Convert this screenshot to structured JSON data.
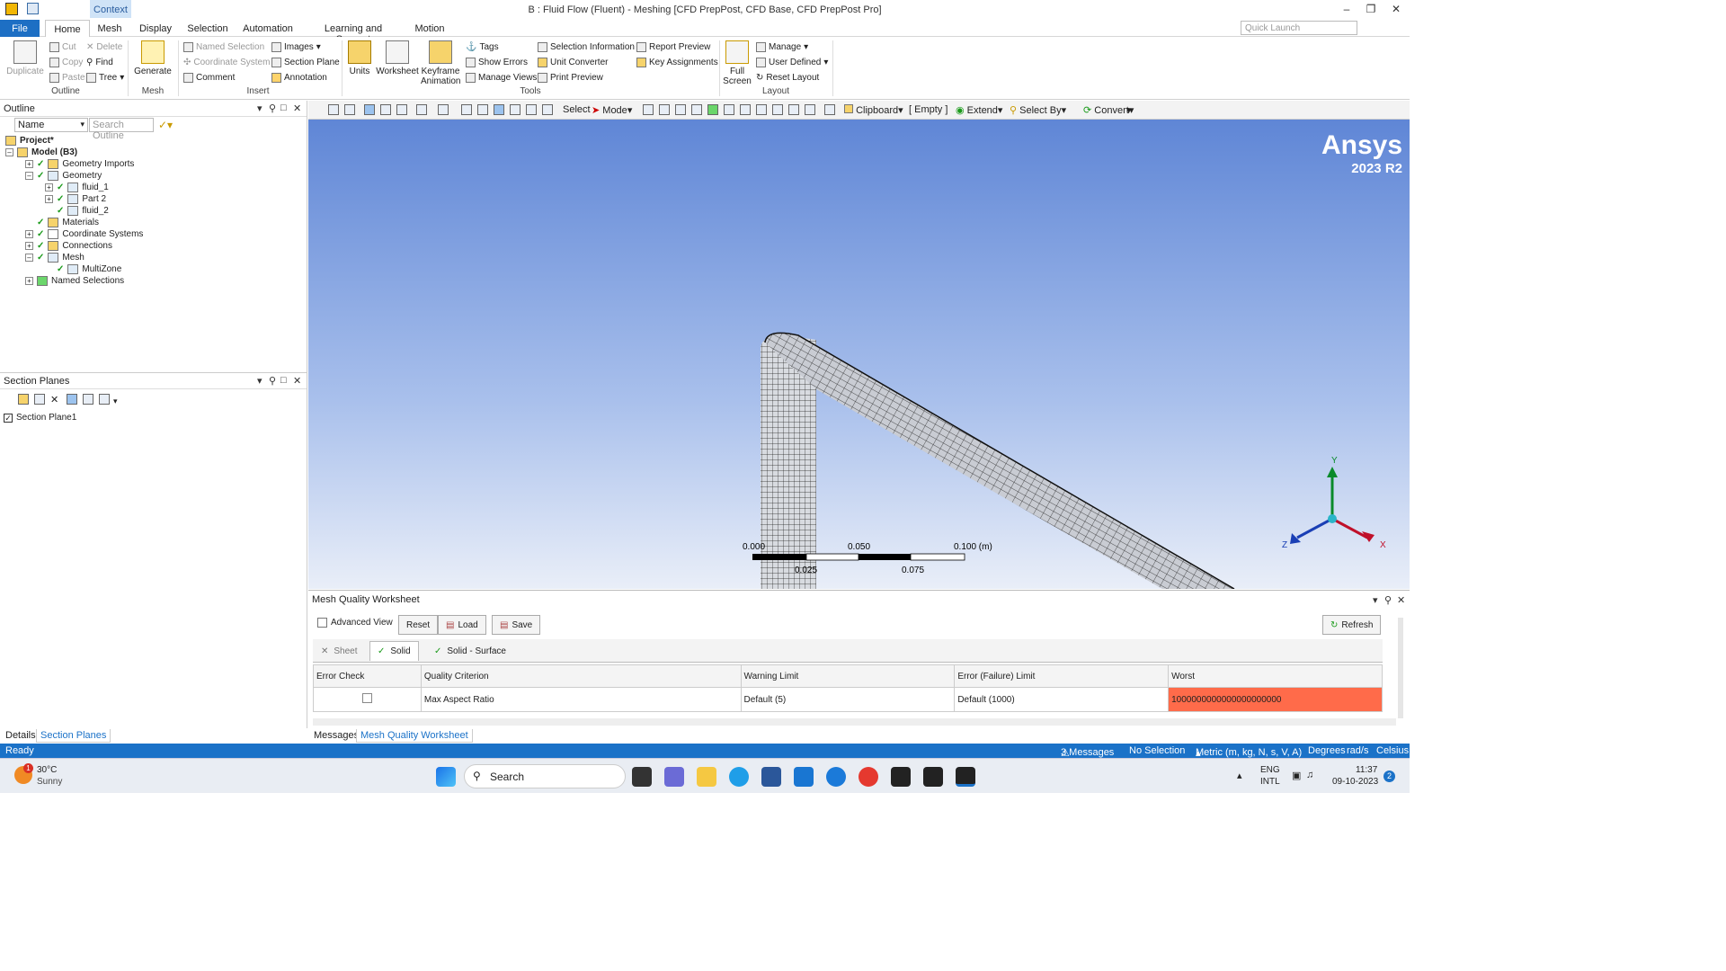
{
  "window": {
    "title": "B : Fluid Flow (Fluent) - Meshing [CFD PrepPost, CFD Base, CFD PrepPost Pro]",
    "context_label": "Context"
  },
  "tabs": [
    "File",
    "Home",
    "Mesh",
    "Display",
    "Selection",
    "Automation",
    "Learning and Support",
    "Motion"
  ],
  "quick_launch": {
    "placeholder": "Quick Launch"
  },
  "ribbon": {
    "outline": {
      "duplicate": "Duplicate",
      "cut": "Cut",
      "copy": "Copy",
      "paste": "Paste",
      "delete": "Delete",
      "find": "Find",
      "tree": "Tree",
      "label": "Outline"
    },
    "mesh": {
      "generate": "Generate",
      "label": "Mesh"
    },
    "insert": {
      "named_selection": "Named Selection",
      "coordinate_system": "Coordinate System",
      "comment": "Comment",
      "images": "Images",
      "section_plane": "Section Plane",
      "annotation": "Annotation",
      "label": "Insert"
    },
    "tools": {
      "units": "Units",
      "worksheet": "Worksheet",
      "keyframe_1": "Keyframe",
      "keyframe_2": "Animation",
      "tags": "Tags",
      "show_errors": "Show Errors",
      "manage_views": "Manage Views",
      "selection_information": "Selection Information",
      "unit_converter": "Unit Converter",
      "print_preview": "Print Preview",
      "report_preview": "Report Preview",
      "key_assignments": "Key Assignments",
      "label": "Tools"
    },
    "layout": {
      "full_1": "Full",
      "full_2": "Screen",
      "manage": "Manage",
      "user_defined": "User Defined",
      "reset_layout": "Reset Layout",
      "label": "Layout"
    }
  },
  "toolbar": {
    "select": "Select",
    "mode": "Mode",
    "clipboard": "Clipboard",
    "empty": "[ Empty ]",
    "extend": "Extend",
    "select_by": "Select By",
    "convert": "Convert"
  },
  "outline": {
    "title": "Outline",
    "filter": "Name",
    "search_placeholder": "Search Outline",
    "tree": [
      {
        "label": "Project*",
        "bold": true
      },
      {
        "label": "Model (B3)",
        "bold": true
      },
      {
        "label": "Geometry Imports"
      },
      {
        "label": "Geometry"
      },
      {
        "label": "fluid_1"
      },
      {
        "label": "Part 2"
      },
      {
        "label": "fluid_2"
      },
      {
        "label": "Materials"
      },
      {
        "label": "Coordinate Systems"
      },
      {
        "label": "Connections"
      },
      {
        "label": "Mesh"
      },
      {
        "label": "MultiZone"
      },
      {
        "label": "Named Selections"
      }
    ]
  },
  "section_planes": {
    "title": "Section Planes",
    "items": [
      "Section Plane1"
    ]
  },
  "viewport": {
    "logo": "Ansys",
    "version": "2023 R2",
    "scale": {
      "labels_top": [
        "0.000",
        "0.050",
        "0.100 (m)"
      ],
      "labels_bottom": [
        "0.025",
        "0.075"
      ]
    },
    "axes": {
      "x": "X",
      "y": "Y",
      "z": "Z"
    }
  },
  "worksheet": {
    "title": "Mesh Quality Worksheet",
    "advanced_view": "Advanced View",
    "reset": "Reset",
    "load": "Load",
    "save": "Save",
    "refresh": "Refresh",
    "tabs": [
      "Sheet",
      "Solid",
      "Solid - Surface"
    ],
    "columns": [
      "Error Check",
      "Quality Criterion",
      "Warning Limit",
      "Error (Failure) Limit",
      "Worst"
    ],
    "rows": [
      {
        "criterion": "Max Aspect Ratio",
        "warning": "Default (5)",
        "error": "Default (1000)",
        "worst": "1000000000000000000000"
      }
    ]
  },
  "bottom_tabs": {
    "left": [
      "Details",
      "Section Planes"
    ],
    "right": [
      "Messages",
      "Mesh Quality Worksheet"
    ]
  },
  "status": {
    "ready": "Ready",
    "messages": "3 Messages",
    "selection": "No Selection",
    "units": "Metric (m, kg, N, s, V, A)",
    "degrees": "Degrees",
    "rads": "rad/s",
    "temp": "Celsius"
  },
  "taskbar": {
    "weather_temp": "30°C",
    "weather_desc": "Sunny",
    "search": "Search",
    "lang1": "ENG",
    "lang2": "INTL",
    "time": "11:37",
    "date": "09-10-2023",
    "badge": "1",
    "notif": "2"
  },
  "colors": {
    "accent": "#1b72c8",
    "worst_cell": "#ff6b4a",
    "check": "#1a9a1a"
  }
}
